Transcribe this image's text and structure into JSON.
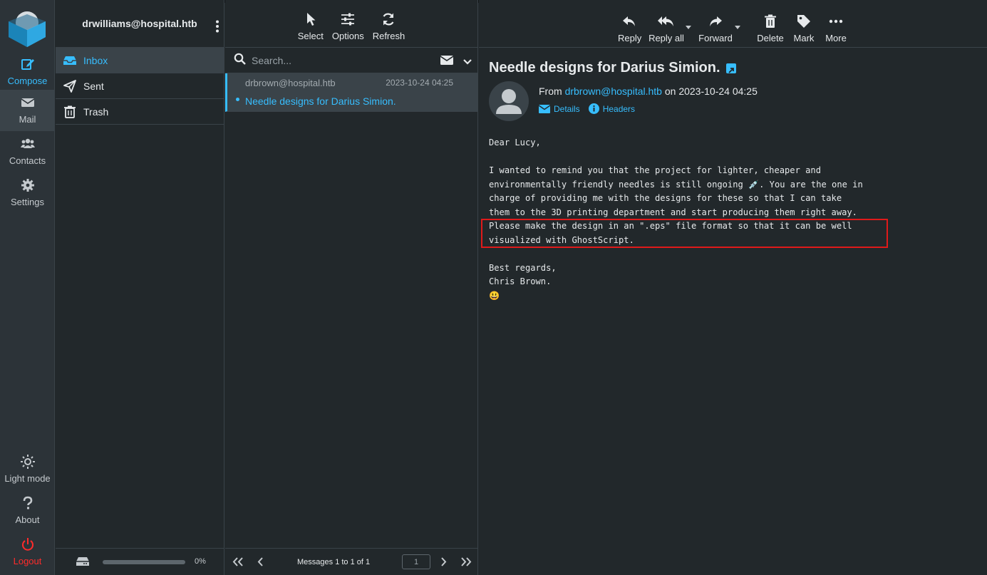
{
  "taskmenu": {
    "compose": "Compose",
    "mail": "Mail",
    "contacts": "Contacts",
    "settings": "Settings",
    "lightmode": "Light mode",
    "about": "About",
    "logout": "Logout"
  },
  "folders": {
    "account": "drwilliams@hospital.htb",
    "items": [
      {
        "label": "Inbox",
        "icon": "inbox-icon"
      },
      {
        "label": "Sent",
        "icon": "paper-plane-icon"
      },
      {
        "label": "Trash",
        "icon": "trash-icon"
      }
    ],
    "quota_percent": 0,
    "quota_label": "0%"
  },
  "list_toolbar": {
    "select": "Select",
    "options": "Options",
    "refresh": "Refresh"
  },
  "search": {
    "placeholder": "Search..."
  },
  "messages": [
    {
      "from": "drbrown@hospital.htb",
      "date": "2023-10-24 04:25",
      "subject": "Needle designs for Darius Simion."
    }
  ],
  "list_footer": {
    "count": "Messages 1 to 1 of 1",
    "page": "1"
  },
  "view_toolbar": {
    "reply": "Reply",
    "reply_all": "Reply all",
    "forward": "Forward",
    "delete": "Delete",
    "mark": "Mark",
    "more": "More"
  },
  "message": {
    "subject": "Needle designs for Darius Simion.",
    "from_prefix": "From",
    "from_address": "drbrown@hospital.htb",
    "on_text": "on 2023-10-24 04:25",
    "details": "Details",
    "headers": "Headers",
    "body_lines": [
      "Dear Lucy,",
      "",
      "I wanted to remind you that the project for lighter, cheaper and",
      "environmentally friendly needles is still ongoing 💉. You are the one in",
      "charge of providing me with the designs for these so that I can take",
      "them to the 3D printing department and start producing them right away.",
      "Please make the design in an \".eps\" file format so that it can be well",
      "visualized with GhostScript.",
      "",
      "Best regards,",
      "Chris Brown.",
      "😃"
    ]
  },
  "colors": {
    "accent": "#37beff",
    "background": "#22282b",
    "panel": "#2c3338",
    "selected": "#3a4349",
    "logout": "#ff2b2b",
    "highlight_box": "#e01a1a"
  }
}
